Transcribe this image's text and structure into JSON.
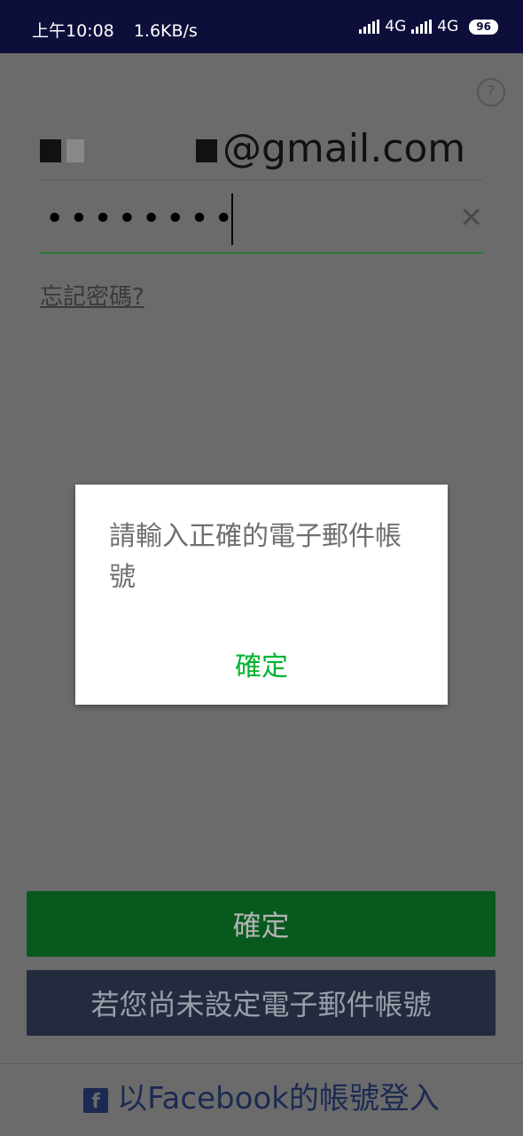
{
  "status_bar": {
    "time": "上午10:08",
    "net_speed": "1.6KB/s",
    "network1": "4G",
    "network2": "4G",
    "battery": "96"
  },
  "form": {
    "help": "?",
    "email_suffix": "@gmail.com",
    "password_mask": "••••••••",
    "forgot": "忘記密碼?"
  },
  "buttons": {
    "confirm": "確定",
    "no_email": "若您尚未設定電子郵件帳號",
    "facebook": "以Facebook的帳號登入",
    "facebook_icon": "f"
  },
  "dialog": {
    "message": "請輸入正確的電子郵件帳號",
    "ok": "確定"
  },
  "colors": {
    "dialog_ok": "#00b330",
    "confirm_bg": "#07591e",
    "status_bg": "#0d0f3a"
  }
}
